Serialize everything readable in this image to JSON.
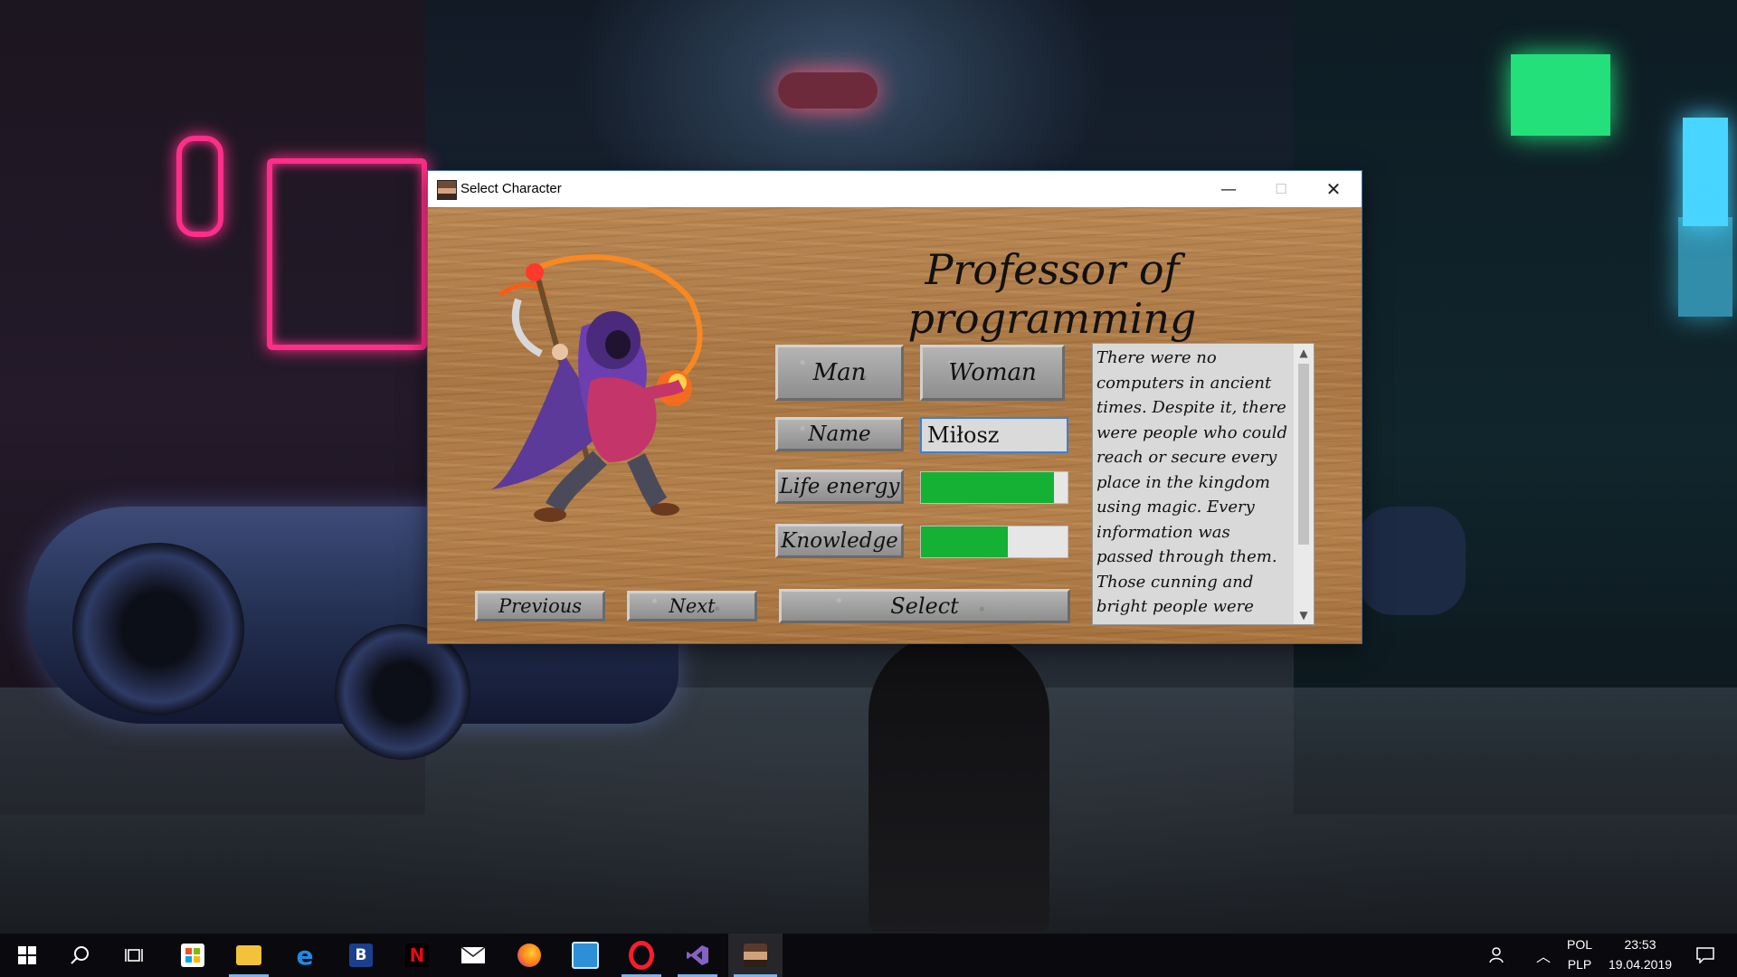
{
  "window": {
    "title": "Select Character",
    "controls": {
      "minimize": "—",
      "maximize": "☐",
      "close": "✕"
    }
  },
  "character": {
    "title": "Professor of programming",
    "gender_options": [
      "Man",
      "Woman"
    ],
    "name_label": "Name",
    "name_value": "Miłosz",
    "life_energy_label": "Life energy",
    "life_energy_level": 0.91,
    "knowledge_label": "Knowledge",
    "knowledge_level": 0.59,
    "description": "There were no computers in ancient times. Despite it, there were people who could reach or secure every place in the kingdom using magic. Every information was passed through them. Those cunning and bright people were known as spies or",
    "nav": {
      "previous": "Previous",
      "next": "Next",
      "select": "Select"
    }
  },
  "colors": {
    "bar_fill": "#14b135",
    "input_border": "#3d7fd6",
    "wood": "#b07d48"
  },
  "taskbar": {
    "apps": [
      "start-icon",
      "search-icon",
      "task-view-icon",
      "store-icon",
      "file-explorer-icon",
      "edge-icon",
      "booking-icon",
      "netflix-icon",
      "mail-icon",
      "firefox-icon",
      "paint-icon",
      "opera-icon",
      "visual-studio-icon",
      "character-app-icon"
    ],
    "letter_b": "B",
    "letter_n": "N",
    "language_top": "POL",
    "language_bottom": "PLP",
    "time": "23:53",
    "date": "19.04.2019"
  }
}
